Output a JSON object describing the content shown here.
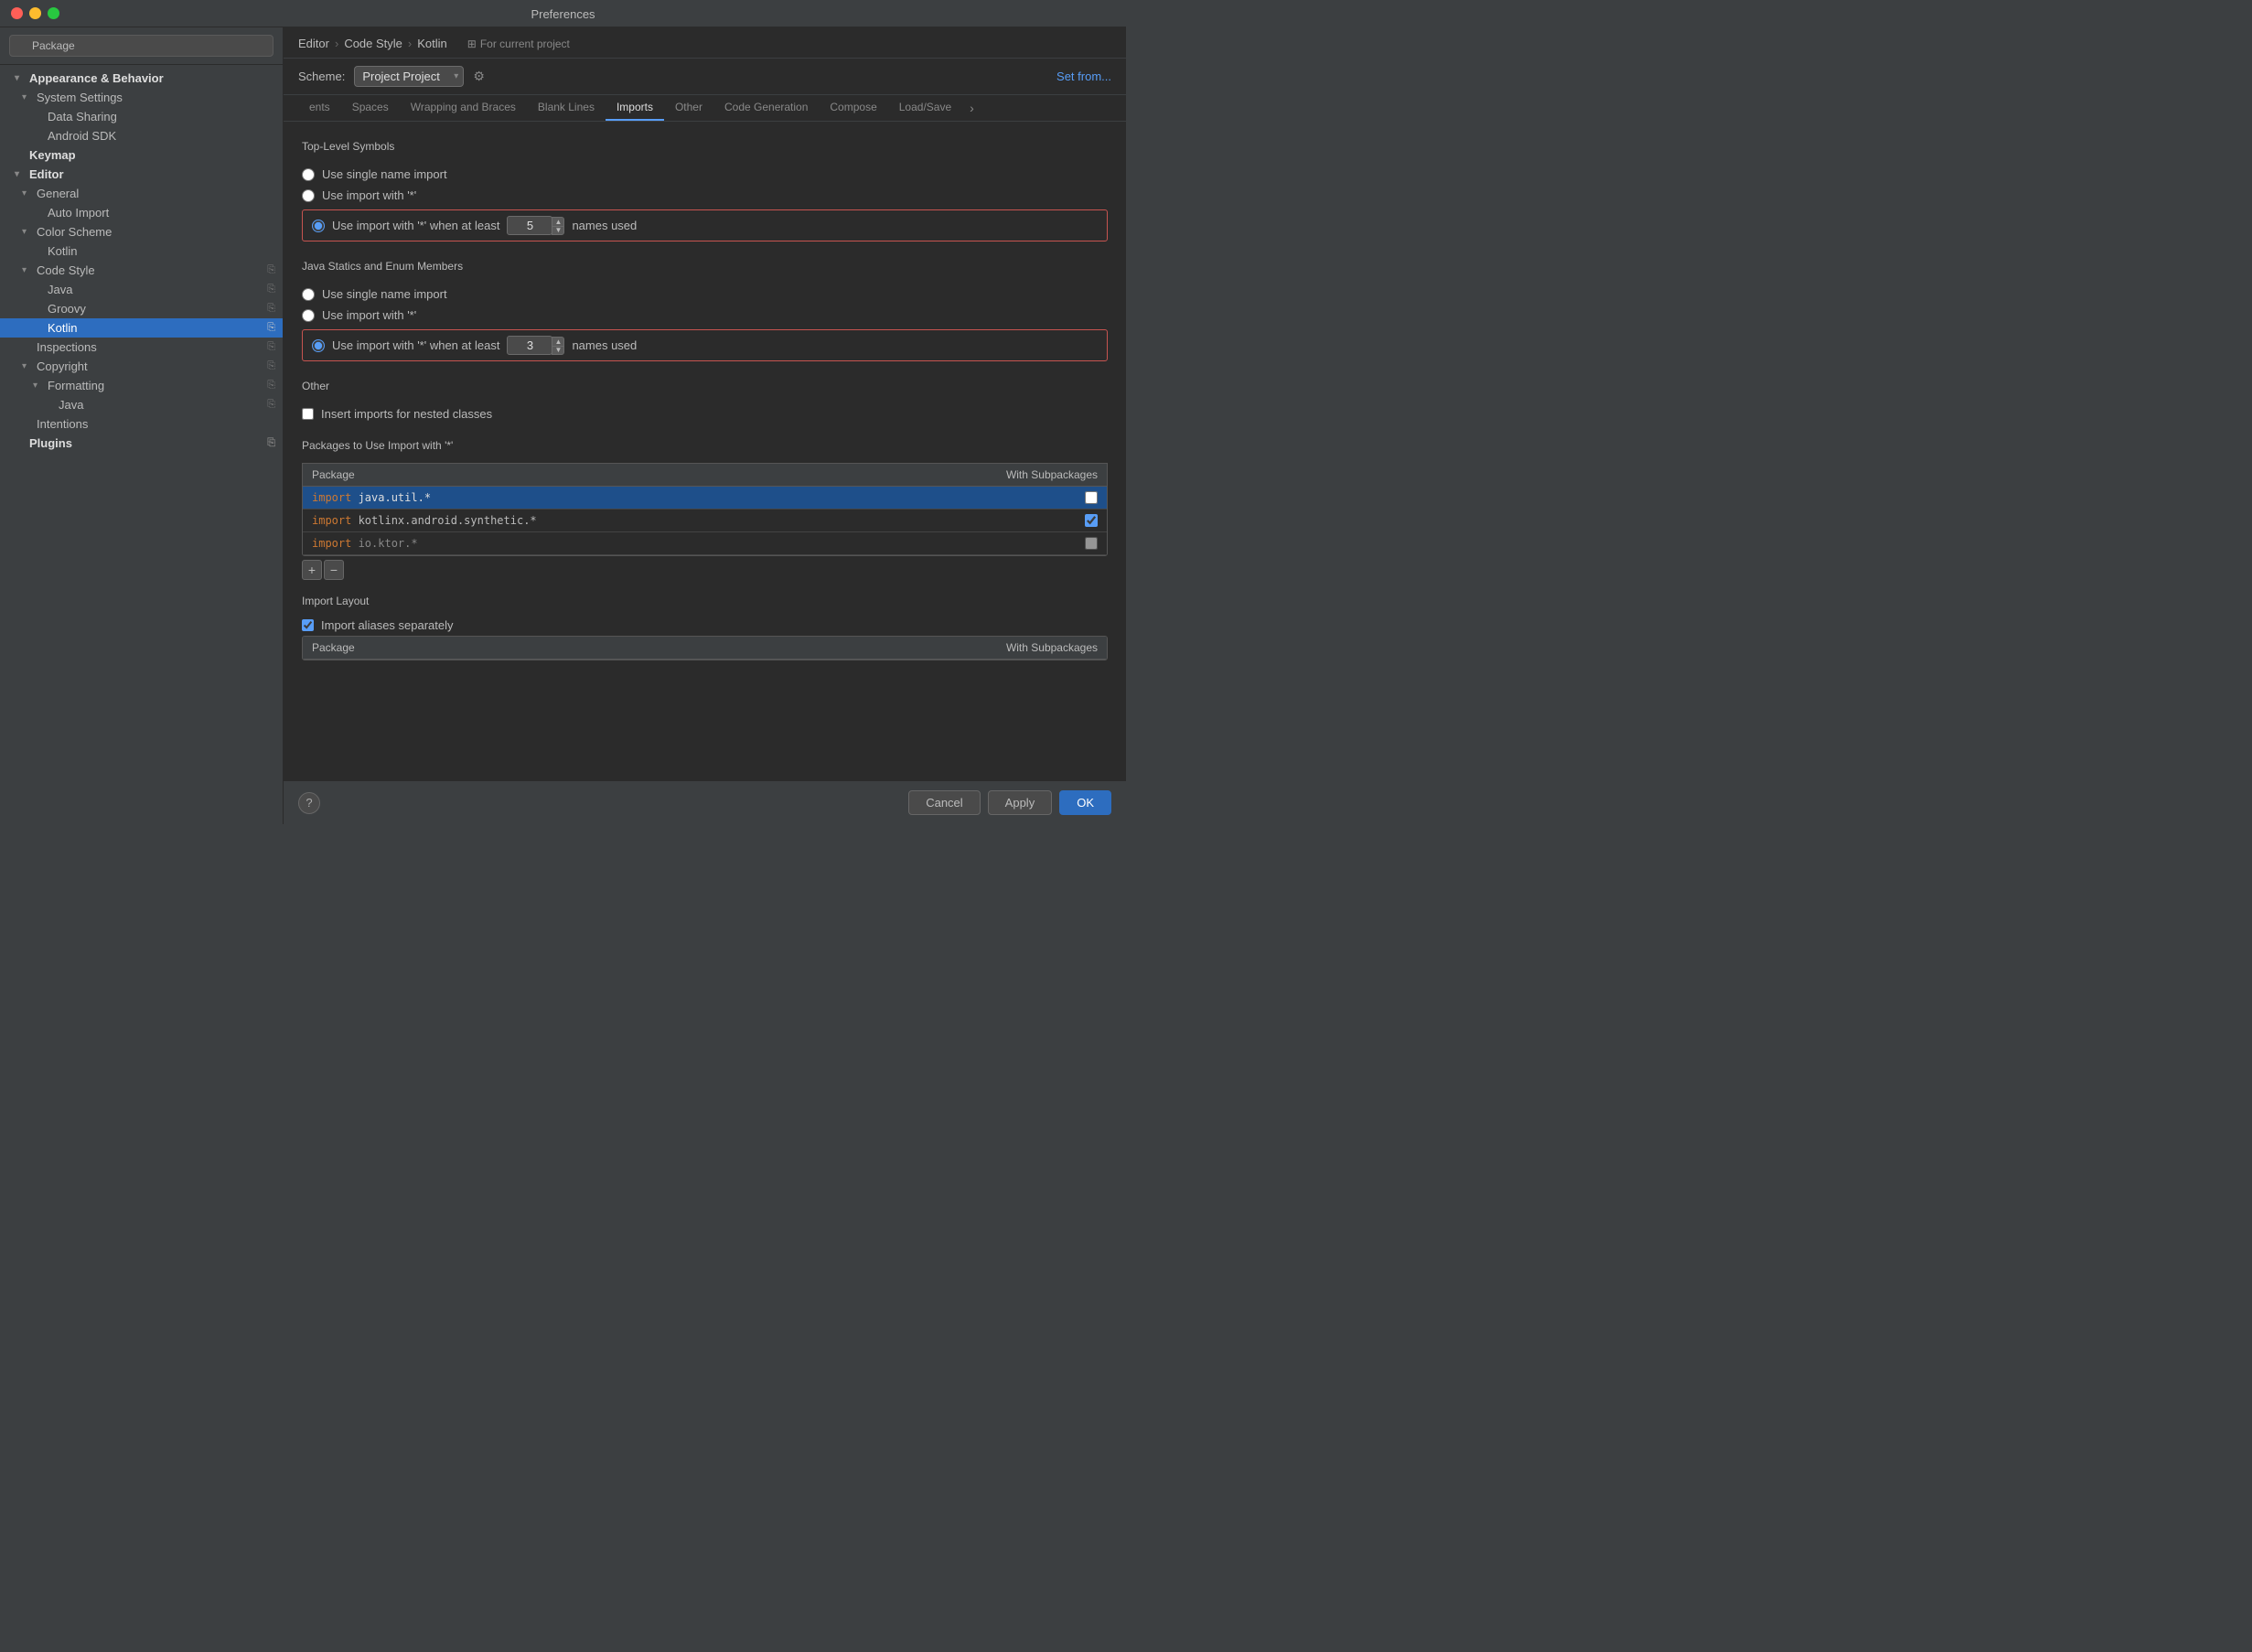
{
  "window": {
    "title": "Preferences"
  },
  "sidebar": {
    "search_placeholder": "Package",
    "items": [
      {
        "id": "appearance-behavior",
        "label": "Appearance & Behavior",
        "level": 0,
        "bold": true,
        "arrow": "▾",
        "has_copy": false
      },
      {
        "id": "system-settings",
        "label": "System Settings",
        "level": 1,
        "bold": false,
        "arrow": "▾",
        "has_copy": false
      },
      {
        "id": "data-sharing",
        "label": "Data Sharing",
        "level": 2,
        "bold": false,
        "arrow": "",
        "has_copy": false
      },
      {
        "id": "android-sdk",
        "label": "Android SDK",
        "level": 2,
        "bold": false,
        "arrow": "",
        "has_copy": false
      },
      {
        "id": "keymap",
        "label": "Keymap",
        "level": 0,
        "bold": true,
        "arrow": "",
        "has_copy": false
      },
      {
        "id": "editor",
        "label": "Editor",
        "level": 0,
        "bold": true,
        "arrow": "▾",
        "has_copy": false
      },
      {
        "id": "general",
        "label": "General",
        "level": 1,
        "bold": false,
        "arrow": "▾",
        "has_copy": false
      },
      {
        "id": "auto-import",
        "label": "Auto Import",
        "level": 2,
        "bold": false,
        "arrow": "",
        "has_copy": false
      },
      {
        "id": "color-scheme",
        "label": "Color Scheme",
        "level": 1,
        "bold": false,
        "arrow": "▾",
        "has_copy": false
      },
      {
        "id": "kotlin-color",
        "label": "Kotlin",
        "level": 2,
        "bold": false,
        "arrow": "",
        "has_copy": false
      },
      {
        "id": "code-style",
        "label": "Code Style",
        "level": 1,
        "bold": false,
        "arrow": "▾",
        "has_copy": true
      },
      {
        "id": "java",
        "label": "Java",
        "level": 2,
        "bold": false,
        "arrow": "",
        "has_copy": true
      },
      {
        "id": "groovy",
        "label": "Groovy",
        "level": 2,
        "bold": false,
        "arrow": "",
        "has_copy": true
      },
      {
        "id": "kotlin",
        "label": "Kotlin",
        "level": 2,
        "bold": false,
        "arrow": "",
        "has_copy": true,
        "selected": true
      },
      {
        "id": "inspections",
        "label": "Inspections",
        "level": 1,
        "bold": false,
        "arrow": "",
        "has_copy": true
      },
      {
        "id": "copyright",
        "label": "Copyright",
        "level": 1,
        "bold": false,
        "arrow": "▾",
        "has_copy": true
      },
      {
        "id": "formatting",
        "label": "Formatting",
        "level": 2,
        "bold": false,
        "arrow": "▾",
        "has_copy": true
      },
      {
        "id": "java-format",
        "label": "Java",
        "level": 3,
        "bold": false,
        "arrow": "",
        "has_copy": true
      },
      {
        "id": "intentions",
        "label": "Intentions",
        "level": 1,
        "bold": false,
        "arrow": "",
        "has_copy": false
      },
      {
        "id": "plugins",
        "label": "Plugins",
        "level": 0,
        "bold": true,
        "arrow": "",
        "has_copy": true
      }
    ]
  },
  "breadcrumb": {
    "parts": [
      "Editor",
      "Code Style",
      "Kotlin"
    ]
  },
  "project_badge": {
    "label": "For current project",
    "icon": "project-icon"
  },
  "scheme": {
    "label": "Scheme:",
    "value": "Project",
    "placeholder": "Project"
  },
  "tabs": [
    {
      "id": "ents",
      "label": "ents"
    },
    {
      "id": "spaces",
      "label": "Spaces"
    },
    {
      "id": "wrapping-braces",
      "label": "Wrapping and Braces"
    },
    {
      "id": "blank-lines",
      "label": "Blank Lines"
    },
    {
      "id": "imports",
      "label": "Imports",
      "active": true
    },
    {
      "id": "other",
      "label": "Other"
    },
    {
      "id": "code-generation",
      "label": "Code Generation"
    },
    {
      "id": "compose",
      "label": "Compose"
    },
    {
      "id": "load-save",
      "label": "Load/Save"
    }
  ],
  "set_from_label": "Set from...",
  "imports_panel": {
    "top_level": {
      "title": "Top-Level Symbols",
      "options": [
        {
          "id": "tl-single",
          "label": "Use single name import",
          "checked": false
        },
        {
          "id": "tl-star",
          "label": "Use import with '*'",
          "checked": false
        },
        {
          "id": "tl-star-atleast",
          "label": "Use import with '*' when at least",
          "checked": true,
          "value": 5,
          "suffix": "names used",
          "highlighted": true
        }
      ]
    },
    "java_statics": {
      "title": "Java Statics and Enum Members",
      "options": [
        {
          "id": "js-single",
          "label": "Use single name import",
          "checked": false
        },
        {
          "id": "js-star",
          "label": "Use import with '*'",
          "checked": false
        },
        {
          "id": "js-star-atleast",
          "label": "Use import with '*' when at least",
          "checked": true,
          "value": 3,
          "suffix": "names used",
          "highlighted": true
        }
      ]
    },
    "other": {
      "title": "Other",
      "options": [
        {
          "id": "nested-classes",
          "label": "Insert imports for nested classes",
          "checked": false
        }
      ]
    },
    "packages_section": {
      "title": "Packages to Use Import with '*'",
      "col_package": "Package",
      "col_subpackages": "With Subpackages",
      "rows": [
        {
          "id": "pkg1",
          "text": "import java.util.*",
          "keyword": "import",
          "rest": " java.util.*",
          "subpackages": false,
          "selected": true
        },
        {
          "id": "pkg2",
          "text": "import kotlinx.android.synthetic.*",
          "keyword": "import",
          "rest": " kotlinx.android.synthetic.*",
          "subpackages": true,
          "selected": false
        },
        {
          "id": "pkg3",
          "text": "import io.ktor.*",
          "keyword": "import",
          "rest": " io.ktor.*",
          "subpackages": true,
          "selected": false,
          "partial": true
        }
      ],
      "add_label": "+",
      "remove_label": "−"
    },
    "import_layout": {
      "title": "Import Layout",
      "options": [
        {
          "id": "import-aliases",
          "label": "Import aliases separately",
          "checked": true
        }
      ],
      "col_package": "Package",
      "col_subpackages": "With Subpackages"
    }
  },
  "bottom_bar": {
    "help_label": "?",
    "cancel_label": "Cancel",
    "apply_label": "Apply",
    "ok_label": "OK"
  }
}
